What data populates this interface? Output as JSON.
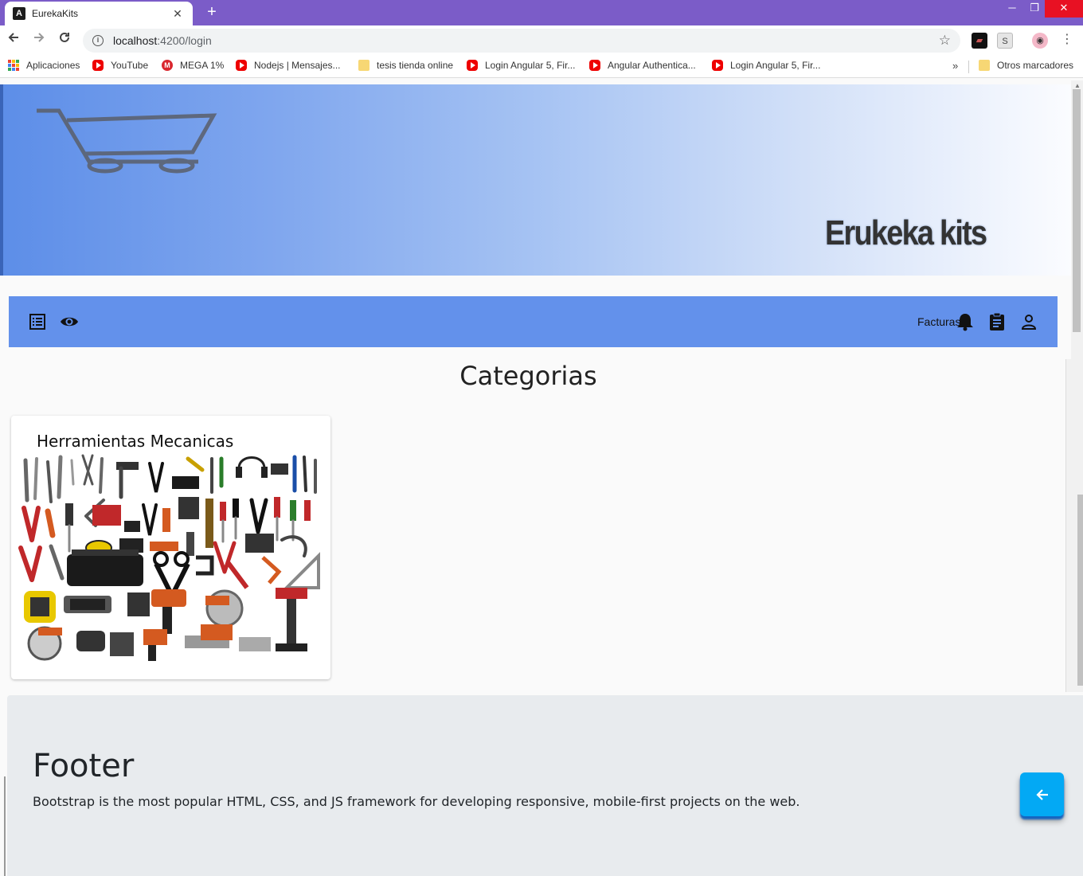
{
  "browser": {
    "tab_title": "EurekaKits",
    "new_tab_symbol": "+",
    "url_host": "localhost",
    "url_path": ":4200/login",
    "bookmarks": [
      {
        "label": "Aplicaciones",
        "icon": "apps-icon"
      },
      {
        "label": "YouTube",
        "icon": "youtube-icon"
      },
      {
        "label": "MEGA 1%",
        "icon": "mega-icon"
      },
      {
        "label": "Nodejs | Mensajes...",
        "icon": "youtube-icon"
      },
      {
        "label": "tesis tienda online",
        "icon": "folder-icon"
      },
      {
        "label": "Login Angular 5, Fir...",
        "icon": "youtube-icon"
      },
      {
        "label": "Angular Authentica...",
        "icon": "youtube-icon"
      },
      {
        "label": "Login Angular 5, Fir...",
        "icon": "youtube-icon"
      }
    ],
    "bookmarks_more": "»",
    "other_bookmarks": "Otros marcadores"
  },
  "banner": {
    "title": "Erukeka kits",
    "logo": "shopping-cart-icon"
  },
  "navbar": {
    "left_icons": [
      "list-icon",
      "eye-icon"
    ],
    "facturas_label": "Facturas",
    "right_icons": [
      "bell-icon",
      "clipboard-icon",
      "person-icon"
    ],
    "color": "#6391eb"
  },
  "main": {
    "heading": "Categorias",
    "categories": [
      {
        "title": "Herramientas Mecanicas",
        "image": "tools-collection-image"
      }
    ]
  },
  "footer": {
    "title": "Footer",
    "text": "Bootstrap is the most popular HTML, CSS, and JS framework for developing responsive, mobile-first projects on the web."
  },
  "fab": {
    "icon": "arrow-left-icon",
    "color": "#03a9f4"
  }
}
